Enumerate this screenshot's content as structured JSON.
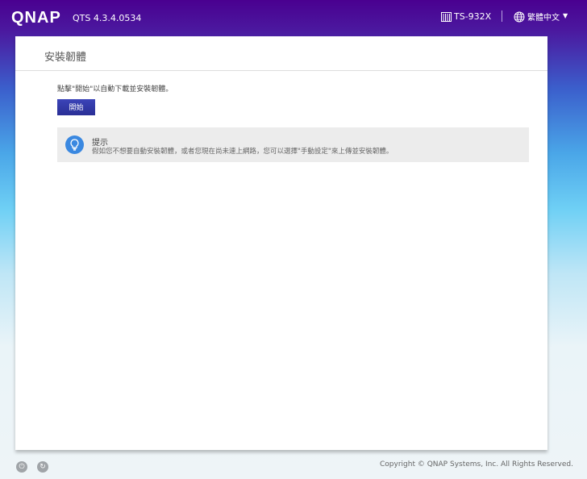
{
  "header": {
    "logo": "QNAP",
    "version": "QTS 4.3.4.0534",
    "model": "TS-932X",
    "language": "繁體中文"
  },
  "panel": {
    "title": "安裝韌體",
    "instruction": "點擊\"開始\"以自動下載並安裝韌體。",
    "start_button": "開始",
    "tip": {
      "title": "提示",
      "text": "假如您不想要自動安裝韌體，或者您現在尚未連上網路，您可以選擇\"手動設定\"來上傳並安裝韌體。"
    }
  },
  "footer": {
    "copyright": "Copyright © QNAP Systems, Inc. All Rights Reserved."
  }
}
